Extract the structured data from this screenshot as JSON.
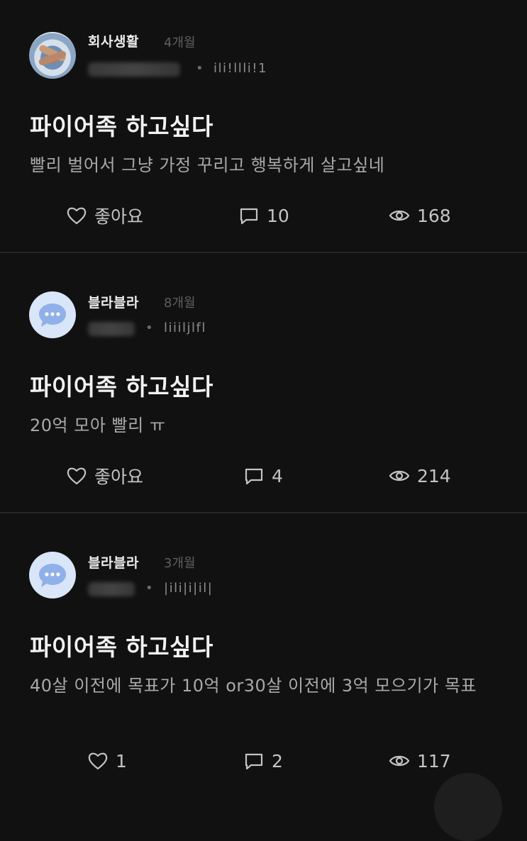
{
  "posts": [
    {
      "board": "회사생활",
      "time": "4개월",
      "nickname": "ili!llli!1",
      "title": "파이어족 하고싶다",
      "body": "빨리 벌어서 그냥 가정 꾸리고 행복하게 살고싶네",
      "likes_label": "좋아요",
      "comments": "10",
      "views": "168",
      "avatar_icon": "team-photo-avatar"
    },
    {
      "board": "블라블라",
      "time": "8개월",
      "nickname": "liiiljlfl",
      "title": "파이어족 하고싶다",
      "body": "20억 모아 빨리 ㅠ",
      "likes_label": "좋아요",
      "comments": "4",
      "views": "214",
      "avatar_icon": "chat-bubble-avatar"
    },
    {
      "board": "블라블라",
      "time": "3개월",
      "nickname": "|ili|i|il|",
      "title": "파이어족 하고싶다",
      "body": "40살 이전에 목표가 10억  or30살 이전에 3억 모으기가 목표",
      "likes_label": "1",
      "comments": "2",
      "views": "117",
      "avatar_icon": "chat-bubble-avatar"
    }
  ],
  "separator": "•",
  "colors": {
    "background": "#111111",
    "divider": "#262626",
    "title": "#f2f2f2",
    "body": "#a9a9a9",
    "muted": "#5f5f5f",
    "bubble_avatar": "#d9e5f8",
    "bubble_icon": "#8fb0e8"
  }
}
